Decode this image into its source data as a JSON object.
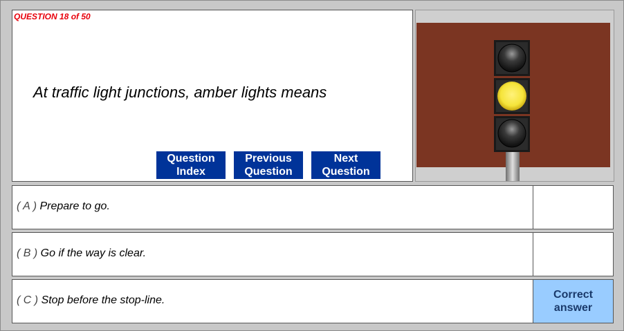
{
  "question": {
    "counter": "QUESTION 18 of 50",
    "text": "At traffic light junctions, amber lights means"
  },
  "nav": {
    "index_label": "Question\nIndex",
    "previous_label": "Previous\nQuestion",
    "next_label": "Next\nQuestion"
  },
  "image": {
    "subject": "traffic-light-amber-icon",
    "background_color": "#7b3522",
    "amber_color": "#f5e43a"
  },
  "answers": [
    {
      "letter": "( A )",
      "text": "Prepare to go.",
      "mark": ""
    },
    {
      "letter": "( B )",
      "text": "Go if the way is clear.",
      "mark": ""
    },
    {
      "letter": "( C )",
      "text": "Stop before the stop-line.",
      "mark": "Correct\nanswer"
    }
  ],
  "colors": {
    "nav_button": "#003399",
    "correct_highlight": "#99ccff",
    "counter_text": "#e8000b"
  }
}
